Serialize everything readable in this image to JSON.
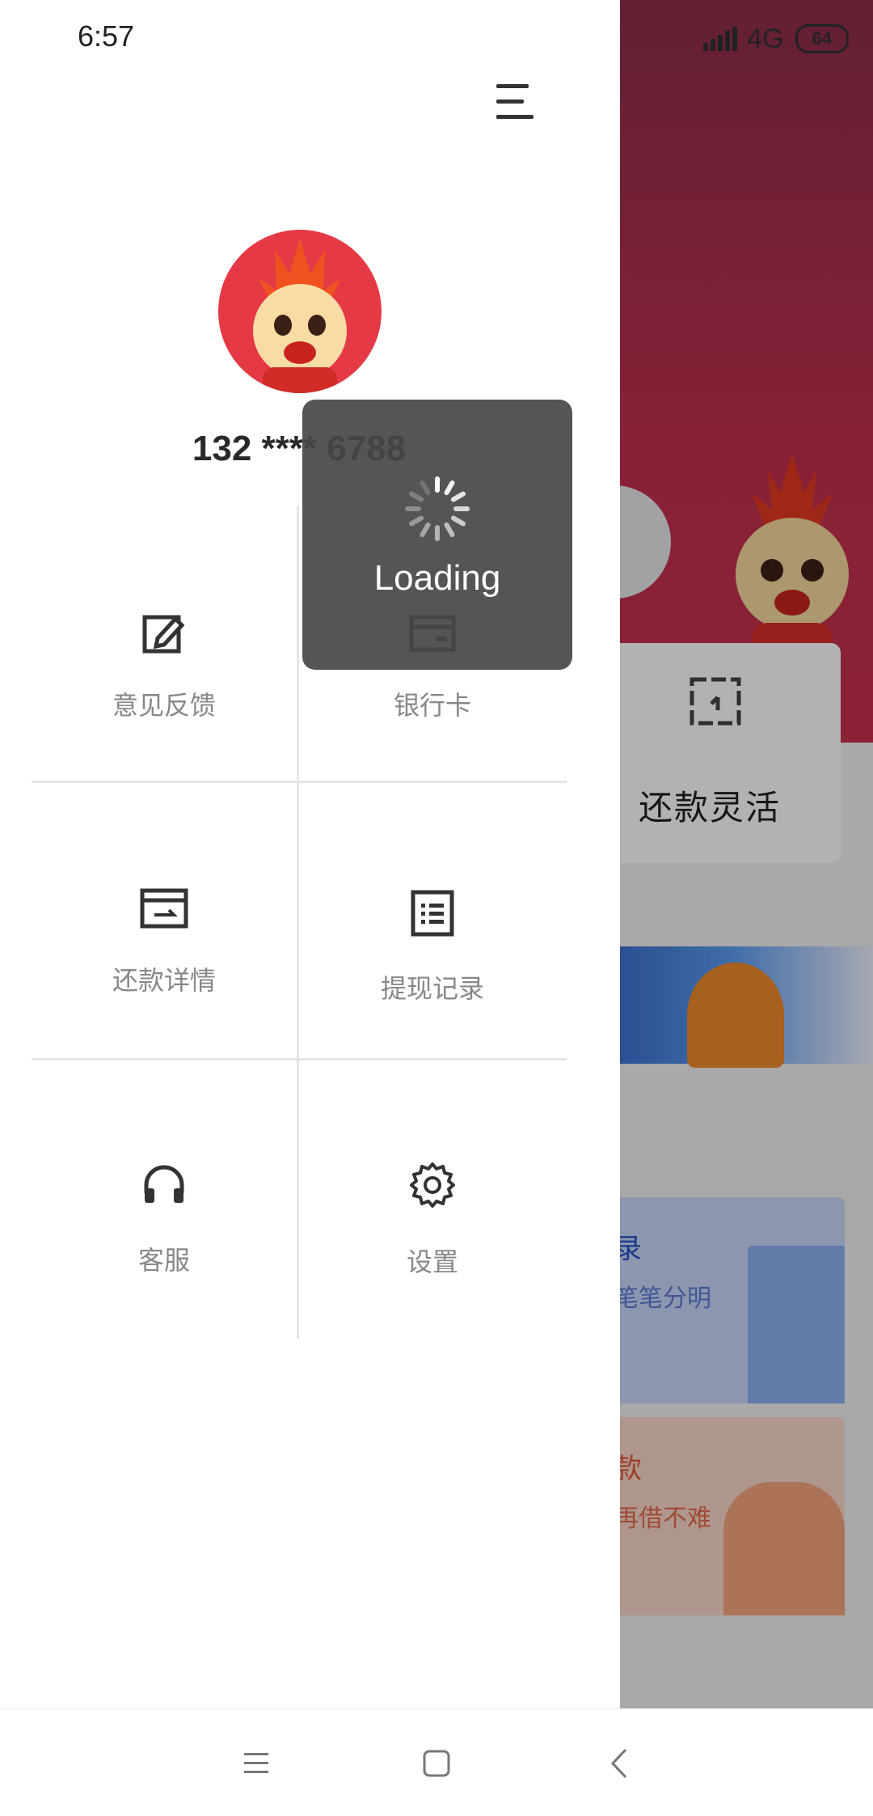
{
  "status_bar": {
    "time": "6:57",
    "network": "4G",
    "battery": "64"
  },
  "drawer": {
    "menu_icon": "hamburger-icon",
    "user": {
      "phone": "132 **** 6788",
      "avatar": "dragon-mascot-avatar"
    },
    "grid": [
      {
        "label": "意见反馈",
        "icon": "edit-icon"
      },
      {
        "label": "银行卡",
        "icon": "card-icon"
      },
      {
        "label": "还款详情",
        "icon": "repayment-icon"
      },
      {
        "label": "提现记录",
        "icon": "list-icon"
      },
      {
        "label": "客服",
        "icon": "headset-icon"
      },
      {
        "label": "设置",
        "icon": "gear-icon"
      }
    ]
  },
  "toast": {
    "text": "Loading"
  },
  "background_page": {
    "card_title": "还款灵活",
    "blue_box": {
      "title": "录",
      "subtitle": "笔笔分明"
    },
    "peach_box": {
      "title": "款",
      "subtitle": "再借不难"
    }
  },
  "nav_bar": {
    "buttons": [
      "menu-icon",
      "home-icon",
      "back-icon"
    ]
  },
  "colors": {
    "banner": "#c2304f",
    "drawer_bg": "#ffffff",
    "toast_bg": "#464646"
  }
}
